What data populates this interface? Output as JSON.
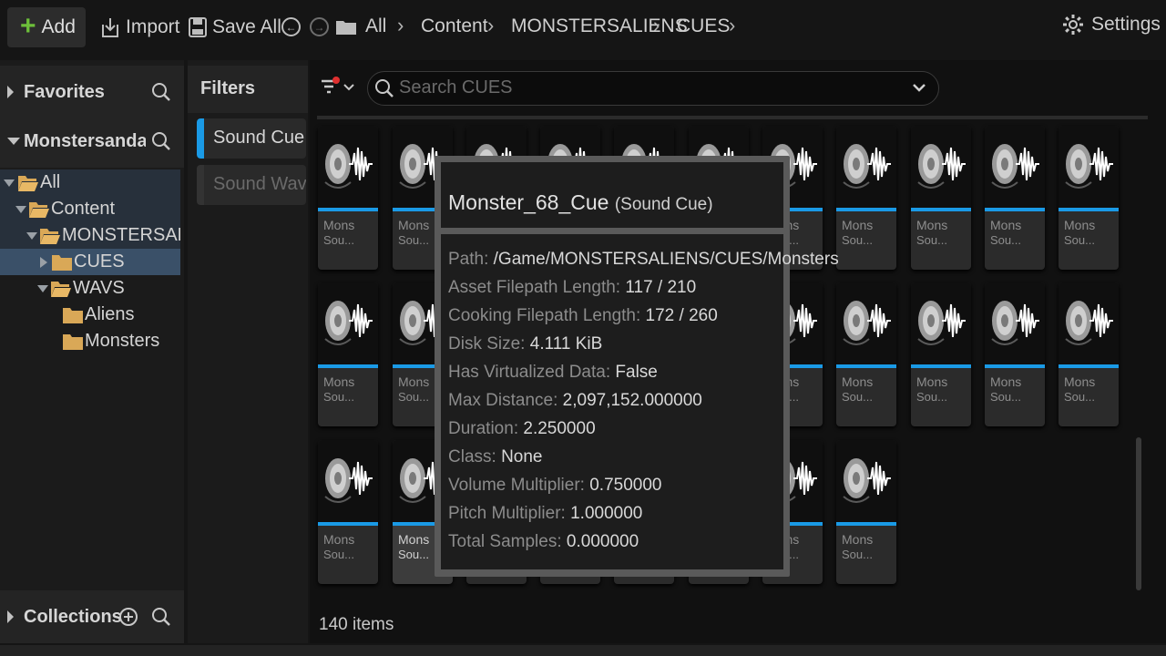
{
  "toolbar": {
    "add_label": "Add",
    "import_label": "Import",
    "save_all_label": "Save All",
    "settings_label": "Settings"
  },
  "breadcrumb": [
    "All",
    "Content",
    "MONSTERSALIENS",
    "CUES"
  ],
  "left": {
    "favorites_label": "Favorites",
    "source_label": "Monstersandaliens",
    "collections_label": "Collections",
    "tree": [
      {
        "label": "All"
      },
      {
        "label": "Content"
      },
      {
        "label": "MONSTERSALIENS"
      },
      {
        "label": "CUES"
      },
      {
        "label": "WAVS"
      },
      {
        "label": "Aliens"
      },
      {
        "label": "Monsters"
      }
    ]
  },
  "filters": {
    "title": "Filters",
    "items": [
      {
        "label": "Sound Cue",
        "color": "#1a9ae6",
        "active": true
      },
      {
        "label": "Sound Wave",
        "color": "#333333",
        "active": false
      }
    ]
  },
  "search": {
    "placeholder": "Search CUES"
  },
  "asset_tile": {
    "name": "Mons",
    "type": "Sou..."
  },
  "status": {
    "items_count": "140 items"
  },
  "tooltip": {
    "title": "Monster_68_Cue",
    "subtitle": "(Sound Cue)",
    "rows": [
      {
        "key": "Path:",
        "value": "/Game/MONSTERSALIENS/CUES/Monsters"
      },
      {
        "key": "Asset Filepath Length:",
        "value": "117 / 210"
      },
      {
        "key": "Cooking Filepath Length:",
        "value": "172 / 260"
      },
      {
        "key": "Disk Size:",
        "value": "4.111 KiB"
      },
      {
        "key": "Has Virtualized Data:",
        "value": "False"
      },
      {
        "key": "Max Distance:",
        "value": "2,097,152.000000"
      },
      {
        "key": "Duration:",
        "value": "2.250000"
      },
      {
        "key": "Class:",
        "value": "None"
      },
      {
        "key": "Volume Multiplier:",
        "value": "0.750000"
      },
      {
        "key": "Pitch Multiplier:",
        "value": "1.000000"
      },
      {
        "key": "Total Samples:",
        "value": "0.000000"
      }
    ]
  },
  "colors": {
    "accent_blue": "#1a9ae6",
    "add_green": "#6dbf3a",
    "folder": "#d9a857",
    "selected_row": "#3a5068"
  }
}
